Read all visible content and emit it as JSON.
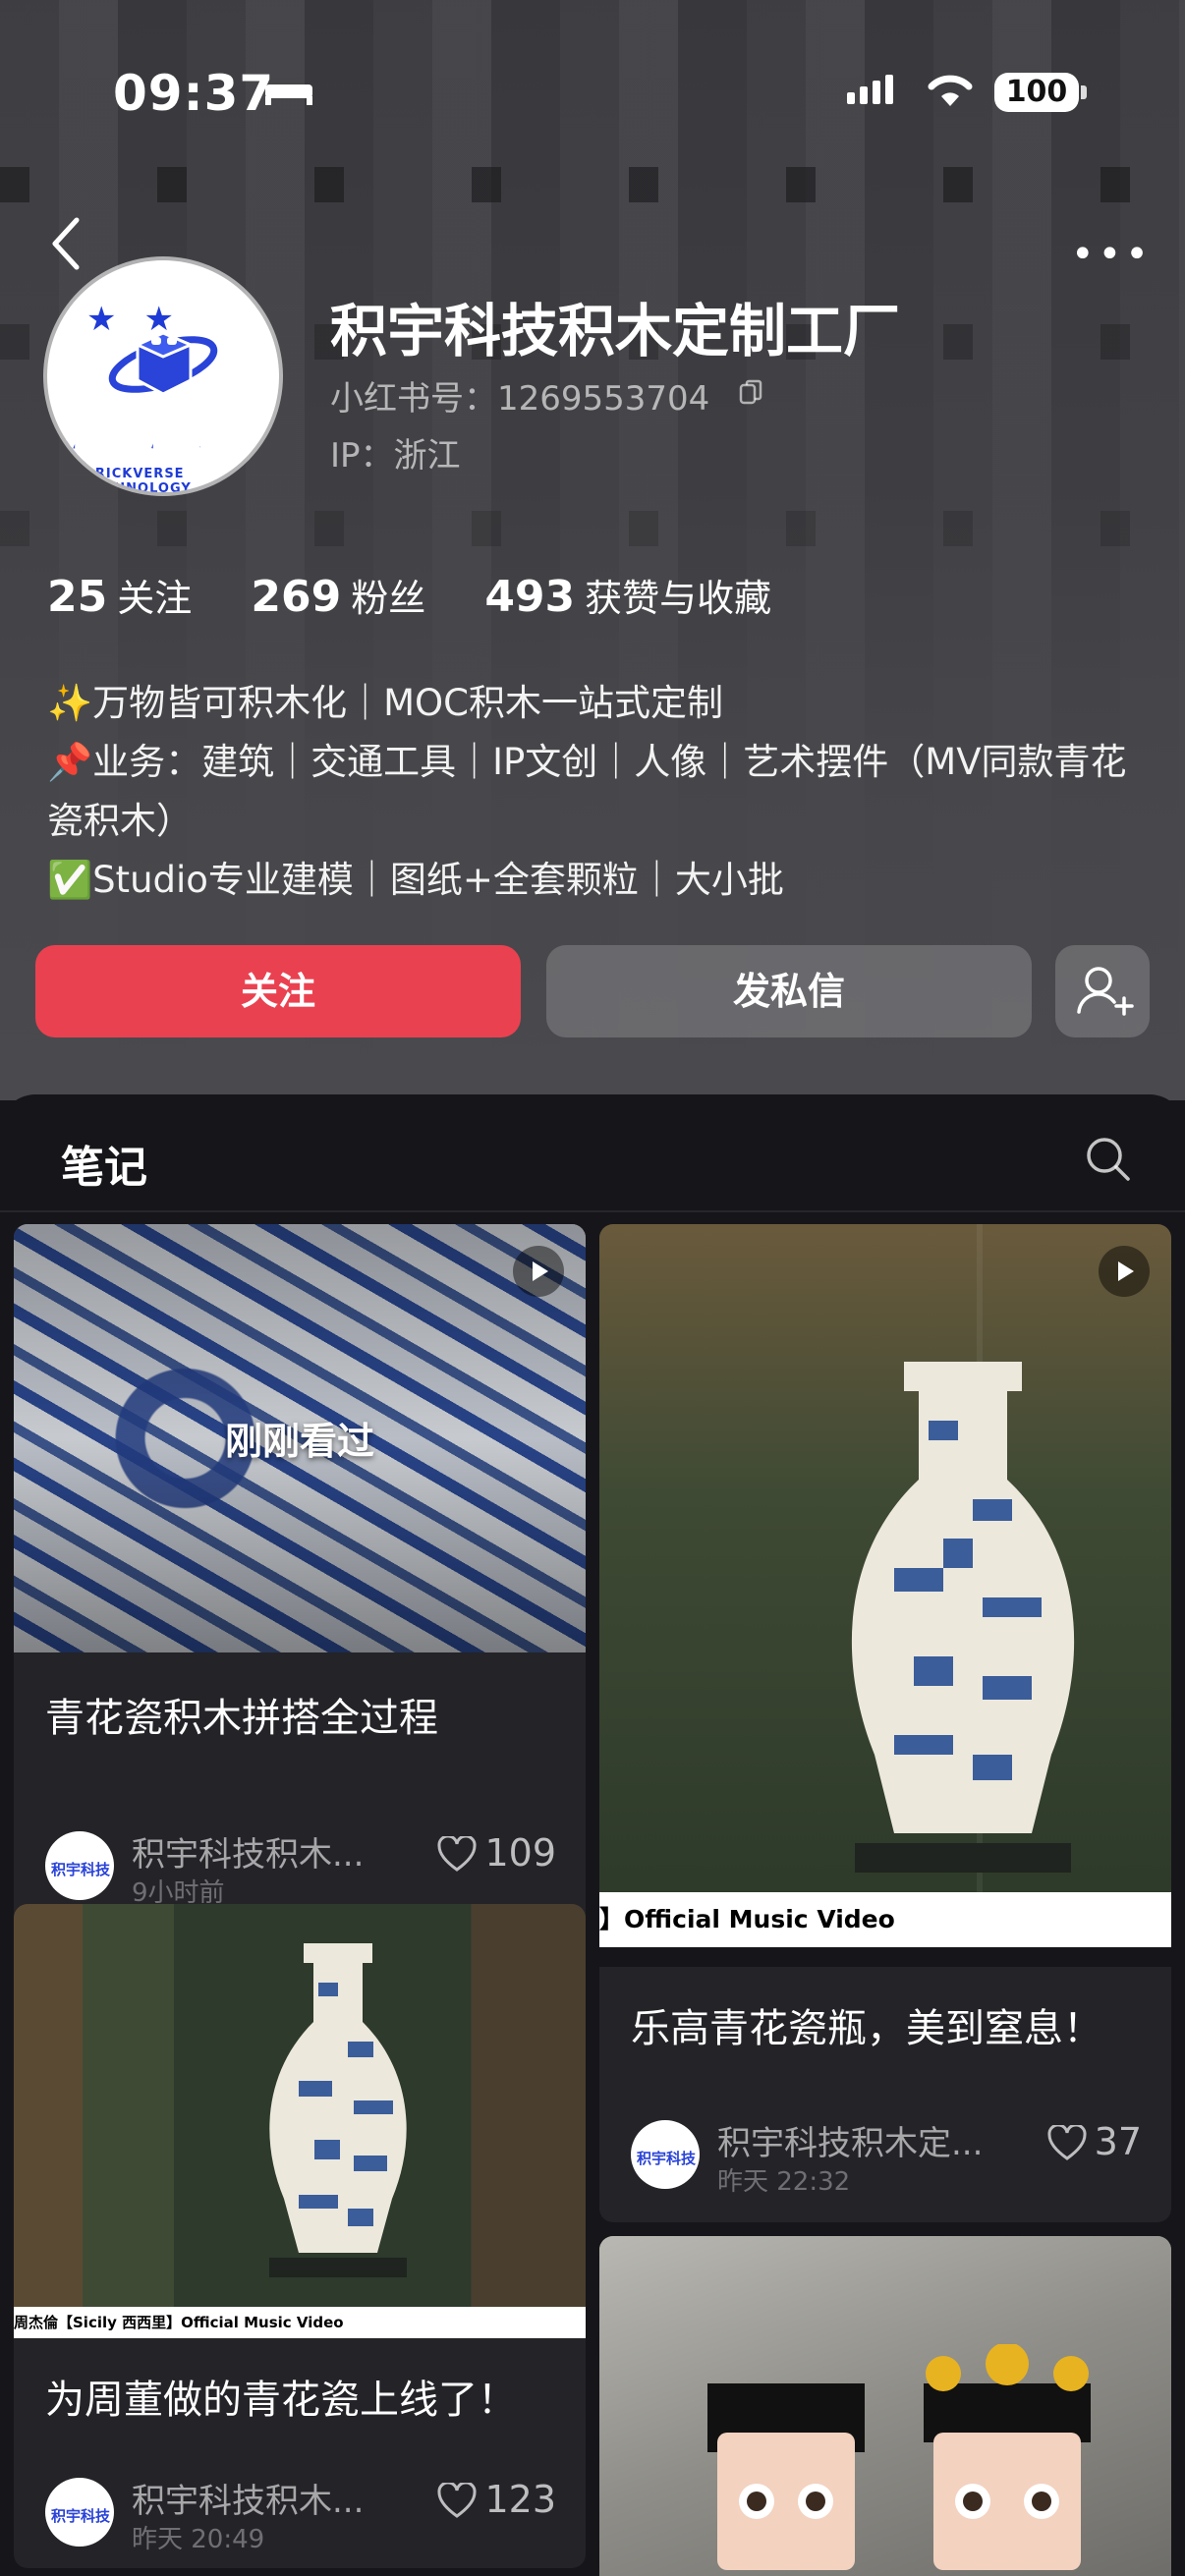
{
  "status_bar": {
    "time": "09:37",
    "battery": "100"
  },
  "profile": {
    "name": "积宇科技积木定制工厂",
    "red_id": "小红书号：1269553704",
    "ip": "IP：浙江",
    "avatar_text": "积宇科技",
    "avatar_sub": "BRICKVERSE TECHNOLOGY",
    "stats": [
      {
        "num": "25",
        "label": "关注"
      },
      {
        "num": "269",
        "label": "粉丝"
      },
      {
        "num": "493",
        "label": "获赞与收藏"
      }
    ],
    "bio": [
      "✨万物皆可积木化｜MOC积木一站式定制",
      "📌业务：建筑｜交通工具｜IP文创｜人像｜艺术摆件（MV同款青花瓷积木）",
      "✅Studio专业建模｜图纸+全套颗粒｜大小批"
    ],
    "follow_label": "关注",
    "message_label": "发私信"
  },
  "notes": {
    "tab_label": "笔记",
    "cards": [
      {
        "title": "青花瓷积木拼搭全过程",
        "author": "积宇科技积木...",
        "time": "9小时前",
        "likes": "109",
        "overlay": "刚刚看过"
      },
      {
        "title": "乐高青花瓷瓶，美到窒息！",
        "author": "积宇科技积木定...",
        "time": "昨天 22:32",
        "likes": "37",
        "subtitle": "】Official Music Video"
      },
      {
        "title": "为周董做的青花瓷上线了！",
        "author": "积宇科技积木...",
        "time": "昨天 20:49",
        "likes": "123",
        "subtitle": "周杰倫【Sicily 西西里】Official Music Video"
      },
      {
        "title": ""
      }
    ]
  },
  "colors": {
    "accent": "#ea4150",
    "background": "#16161a",
    "card": "#232328"
  }
}
